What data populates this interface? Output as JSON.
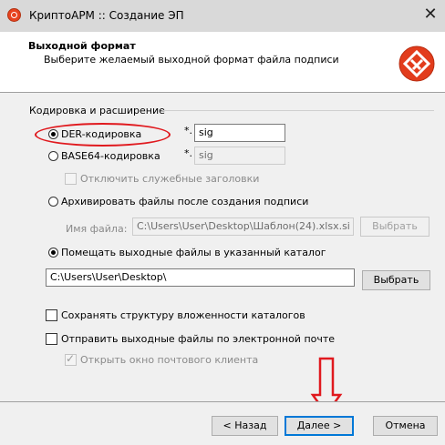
{
  "window": {
    "title": "КриптоАРМ :: Создание ЭП",
    "close_glyph": "✕"
  },
  "header": {
    "title": "Выходной формат",
    "subtitle": "Выберите желаемый выходной формат файла подписи",
    "logo_icon": "cryptoarm-logo-icon"
  },
  "encoding_group": {
    "label": "Кодировка и расширение",
    "der": {
      "label": "DER-кодировка",
      "selected": true,
      "ext_prefix": "*.",
      "ext_value": "sig"
    },
    "base64": {
      "label": "BASE64-кодировка",
      "selected": false,
      "ext_prefix": "*.",
      "ext_value": "sig"
    },
    "disable_headers": {
      "label": "Отключить служебные заголовки",
      "checked": false,
      "enabled": false
    }
  },
  "archive": {
    "label": "Архивировать файлы после создания подписи",
    "selected": false,
    "filename_label": "Имя файла:",
    "filename_value": "C:\\Users\\User\\Desktop\\Шаблон(24).xlsx.si",
    "browse_label": "Выбрать"
  },
  "output_dir": {
    "label": "Помещать выходные файлы в указанный каталог",
    "selected": true,
    "path_value": "C:\\Users\\User\\Desktop\\",
    "browse_label": "Выбрать"
  },
  "options": {
    "keep_structure": {
      "label": "Сохранять структуру вложенности каталогов",
      "checked": false
    },
    "send_email": {
      "label": "Отправить выходные файлы по электронной почте",
      "checked": false
    },
    "open_mail_client": {
      "label": "Открыть окно почтового клиента",
      "checked": true,
      "enabled": false
    }
  },
  "footer": {
    "back_label": "< Назад",
    "next_label": "Далее >",
    "cancel_label": "Отмена"
  },
  "annotations": {
    "highlight_color": "#e0191e",
    "accent_color": "#0078d7"
  }
}
